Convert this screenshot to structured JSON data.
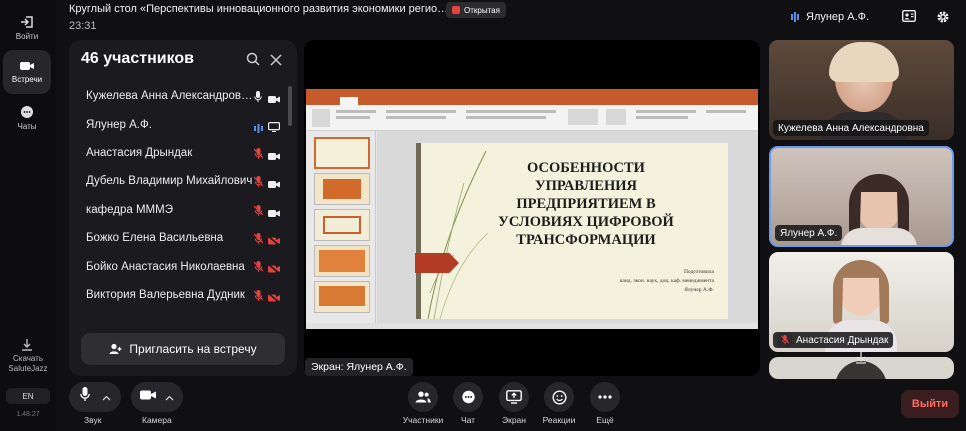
{
  "rail": {
    "items": [
      {
        "label": "Войти"
      },
      {
        "label": "Встречи"
      },
      {
        "label": "Чаты"
      }
    ],
    "download_label": "Скачать\nSaluteJazz",
    "lang": "EN",
    "version": "1.48.27"
  },
  "header": {
    "title": "Круглый стол «Перспективы инновационного развития экономики регио…",
    "badge": "Открытая",
    "time": "23:31",
    "speaker": "Ялунер А.Ф."
  },
  "participants": {
    "title": "46 участников",
    "items": [
      {
        "name": "Кужелева Анна Александровна",
        "mic": "on",
        "cam": "on"
      },
      {
        "name": "Ялунер А.Ф.",
        "mic": "speaking",
        "cam": "screen"
      },
      {
        "name": "Анастасия Дрындак",
        "mic": "off",
        "cam": "on"
      },
      {
        "name": "Дубель Владимир Михайлович",
        "mic": "off",
        "cam": "on"
      },
      {
        "name": "кафедра МММЭ",
        "mic": "off",
        "cam": "on"
      },
      {
        "name": "Божко Елена Васильевна",
        "mic": "off",
        "cam": "off"
      },
      {
        "name": "Бойко Анастасия Николаевна",
        "mic": "off",
        "cam": "off"
      },
      {
        "name": "Виктория Валерьевна Дудник",
        "mic": "off",
        "cam": "off"
      }
    ],
    "invite_label": "Пригласить на встречу"
  },
  "screen": {
    "label": "Экран: Ялунер А.Ф.",
    "slide_title": "ОСОБЕННОСТИ\nУПРАВЛЕНИЯ\nПРЕДПРИЯТИЕМ В\nУСЛОВИЯХ ЦИФРОВОЙ\nТРАНСФОРМАЦИИ",
    "slide_author": "Подготовила\nканд. экон. наук, доц. каф. менеджмента\nЯлунер А.Ф."
  },
  "tiles": [
    {
      "name": "Кужелева Анна Александровна"
    },
    {
      "name": "Ялунер А.Ф."
    },
    {
      "name": "Анастасия Дрындак"
    }
  ],
  "controls": {
    "sound": "Звук",
    "camera": "Камера",
    "participants": "Участники",
    "chat": "Чат",
    "screen": "Экран",
    "reactions": "Реакции",
    "more": "Ещё",
    "exit": "Выйти"
  },
  "colors": {
    "muted": "#e8413d",
    "speaking": "#5b8def",
    "ppt_accent": "#c55a2b",
    "exit_text": "#ff6b66"
  }
}
